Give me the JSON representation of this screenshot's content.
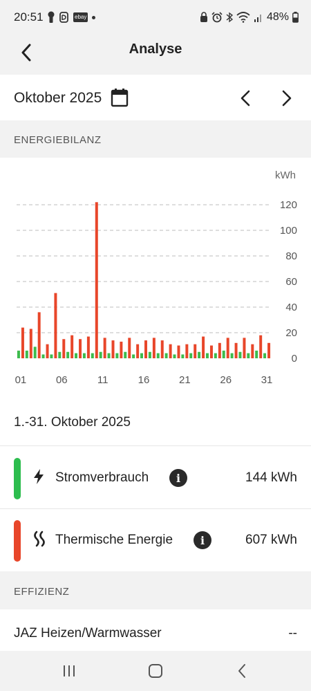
{
  "status_bar": {
    "time": "20:51",
    "battery": "48%",
    "left_icons": [
      "keyhole-icon",
      "app-icon",
      "ebay-icon",
      "dot-icon"
    ],
    "ebay_label": "ebay",
    "right_icons": [
      "lock-icon",
      "alarm-icon",
      "bluetooth-icon",
      "wifi-icon",
      "signal-icon",
      "battery-icon"
    ]
  },
  "app_bar": {
    "title": "Analyse",
    "back_icon": "chevron-left-icon"
  },
  "period": {
    "label": "Oktober 2025",
    "calendar_icon": "calendar-icon"
  },
  "sections": {
    "energy_header": "ENERGIEBILANZ",
    "efficiency_header": "EFFIZIENZ"
  },
  "chart_data": {
    "type": "bar",
    "unit": "kWh",
    "y_ticks": [
      "120",
      "100",
      "80",
      "60",
      "40",
      "20",
      "0"
    ],
    "ylim": [
      0,
      120
    ],
    "x_tick_labels": [
      "01",
      "06",
      "11",
      "16",
      "21",
      "26",
      "31"
    ],
    "categories": [
      "01",
      "02",
      "03",
      "04",
      "05",
      "06",
      "07",
      "08",
      "09",
      "10",
      "11",
      "12",
      "13",
      "14",
      "15",
      "16",
      "17",
      "18",
      "19",
      "20",
      "21",
      "22",
      "23",
      "24",
      "25",
      "26",
      "27",
      "28",
      "29",
      "30",
      "31"
    ],
    "series": [
      {
        "name": "Stromverbrauch",
        "color": "#3dbb4c",
        "values": [
          6,
          6,
          9,
          3,
          3,
          5,
          5,
          4,
          4,
          4,
          5,
          4,
          4,
          5,
          3,
          4,
          5,
          4,
          4,
          3,
          3,
          4,
          5,
          4,
          4,
          6,
          4,
          5,
          4,
          6,
          4
        ]
      },
      {
        "name": "Thermische Energie",
        "color": "#e8462a",
        "values": [
          24,
          23,
          36,
          11,
          51,
          15,
          18,
          15,
          17,
          122,
          16,
          14,
          13,
          16,
          11,
          14,
          16,
          14,
          11,
          10,
          11,
          11,
          17,
          10,
          12,
          16,
          12,
          16,
          11,
          18,
          12
        ]
      }
    ],
    "grid": "dashed"
  },
  "summary": {
    "range": "1.-31. Oktober 2025",
    "items": [
      {
        "label": "Stromverbrauch",
        "value": "144 kWh",
        "color": "#2dbd4e",
        "icon": "lightning-icon"
      },
      {
        "label": "Thermische Energie",
        "value": "607 kWh",
        "color": "#e8462a",
        "icon": "heat-waves-icon"
      }
    ]
  },
  "efficiency": {
    "label": "JAZ Heizen/Warmwasser",
    "value": "--"
  },
  "nav_bar": {
    "icons": [
      "recents-icon",
      "home-icon",
      "back-icon"
    ]
  }
}
